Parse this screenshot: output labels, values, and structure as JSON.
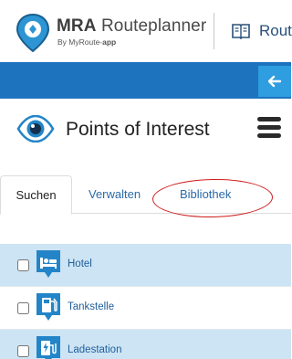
{
  "header": {
    "logo": {
      "brand_bold": "MRA",
      "brand_rest": "Routeplanner",
      "sub_prefix": "By MyRoute-",
      "sub_suffix": "app"
    },
    "nav_label": "Rout"
  },
  "panel": {
    "title": "Points of Interest"
  },
  "tabs": {
    "suchen": "Suchen",
    "verwalten": "Verwalten",
    "bibliothek": "Bibliothek"
  },
  "poi_list": [
    {
      "label": "Hotel",
      "icon": "hotel-bed-icon",
      "checked": false
    },
    {
      "label": "Tankstelle",
      "icon": "fuel-pump-icon",
      "checked": false
    },
    {
      "label": "Ladestation",
      "icon": "charging-station-icon",
      "checked": false
    }
  ],
  "colors": {
    "accent_blue": "#1e73be",
    "light_blue": "#2e9ee0",
    "row_highlight": "#cde4f4",
    "annotation_red": "#d01c1c",
    "link_blue": "#2a6aa8"
  }
}
